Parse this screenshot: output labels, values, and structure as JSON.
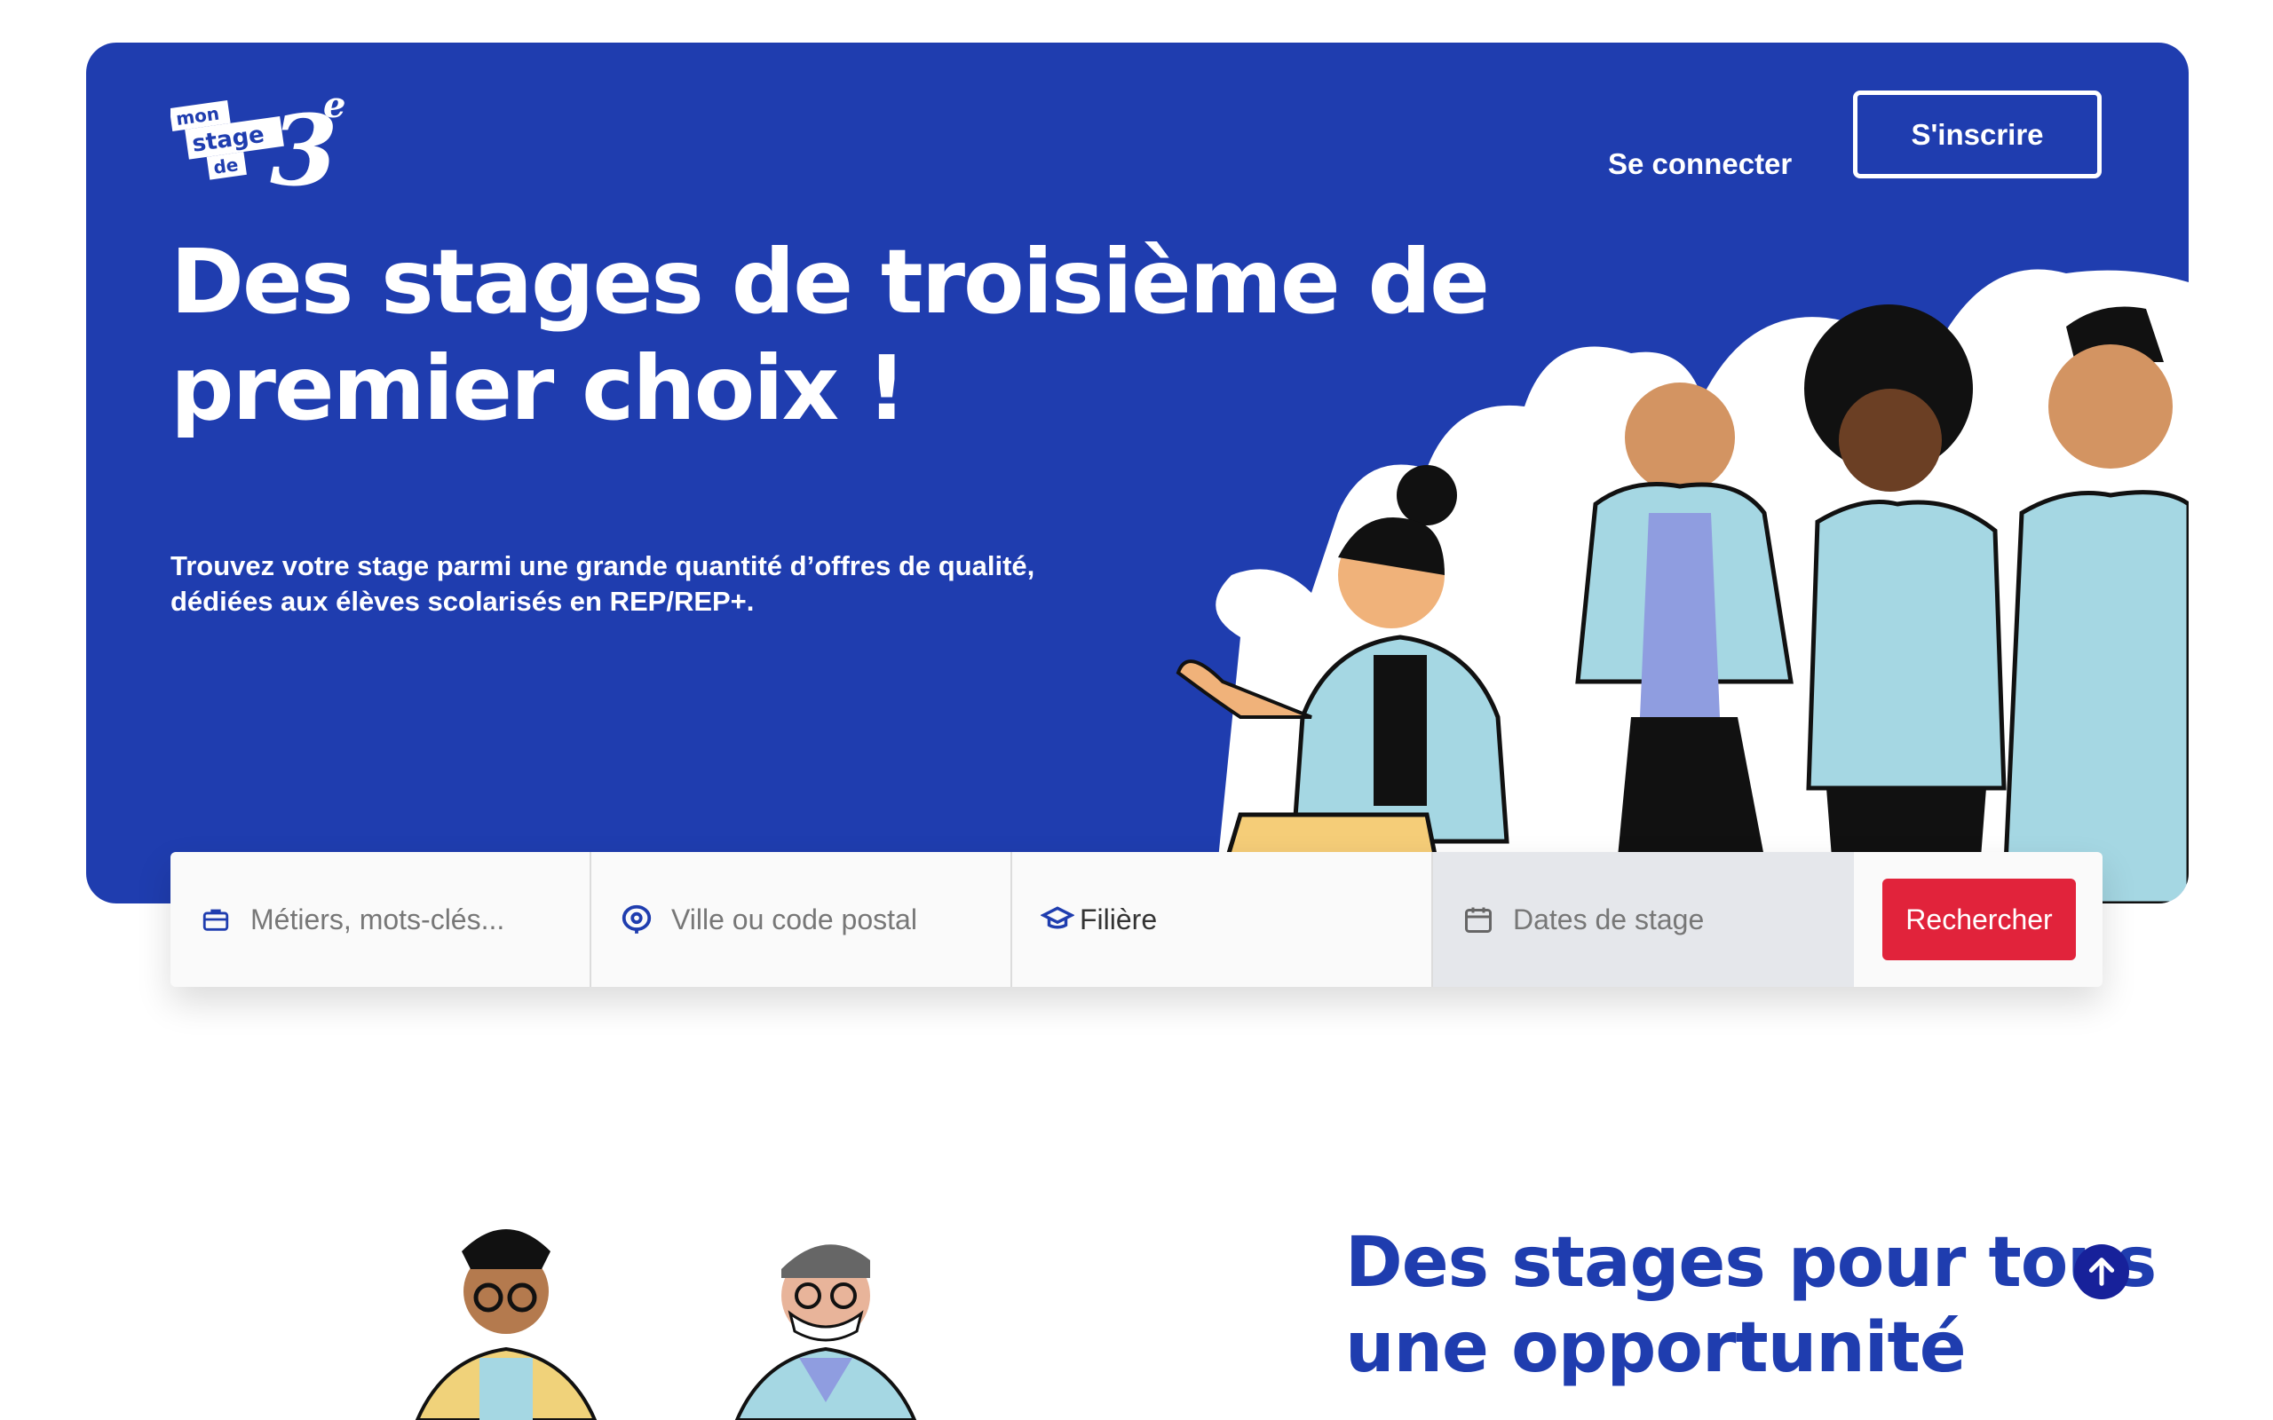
{
  "header": {
    "logo": {
      "line1": "mon",
      "line2": "stage",
      "line3": "de",
      "big": "3",
      "sup": "e"
    },
    "login_label": "Se connecter",
    "signup_label": "S'inscrire"
  },
  "hero": {
    "title": "Des stages de troisième de premier choix !",
    "subtitle_line1": "Trouvez votre stage parmi une grande quantité d’offres de qualité,",
    "subtitle_line2": "dédiées aux élèves scolarisés en REP/REP+."
  },
  "search": {
    "keywords_placeholder": "Métiers, mots-clés...",
    "city_placeholder": "Ville ou code postal",
    "track_label": "Filière",
    "dates_placeholder": "Dates de stage",
    "submit_label": "Rechercher"
  },
  "section": {
    "title_line1": "Des stages pour tous",
    "title_line2": "une opportunité"
  },
  "colors": {
    "brand_blue": "#1f3daf",
    "search_red": "#e1233b",
    "scroll_btn": "#17219a"
  }
}
